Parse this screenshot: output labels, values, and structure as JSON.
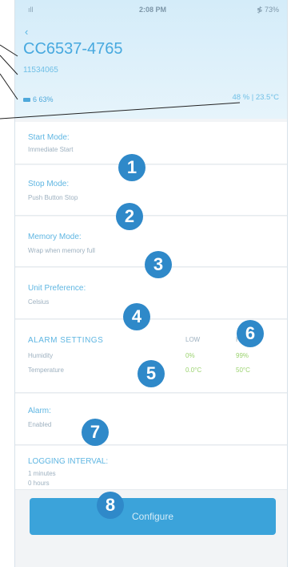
{
  "status_bar": {
    "signal": "ıll",
    "time": "2:08 PM",
    "battery": "≸ 73%"
  },
  "header": {
    "back": "‹",
    "device_name": "CC6537-4765",
    "device_sub": "11534065",
    "battery": "6 63%",
    "readings": "48 % | 23.5°C"
  },
  "settings": {
    "start_mode": {
      "label": "Start Mode:",
      "value": "Immediate Start"
    },
    "stop_mode": {
      "label": "Stop Mode:",
      "value": "Push Button Stop"
    },
    "memory_mode": {
      "label": "Memory Mode:",
      "value": "Wrap when memory full"
    },
    "unit_pref": {
      "label": "Unit Preference:",
      "value": "Celsius"
    },
    "alarm_settings": {
      "heading": "ALARM SETTINGS",
      "col_low": "LOW",
      "col_high": "HIGH",
      "rows": [
        {
          "name": "Humidity",
          "low": "0%",
          "high": "99%"
        },
        {
          "name": "Temperature",
          "low": "0.0°C",
          "high": "50°C"
        }
      ]
    },
    "alarm": {
      "label": "Alarm:",
      "value": "Enabled"
    },
    "logging": {
      "label": "LOGGING INTERVAL:",
      "line1": "1 minutes",
      "line2": "0 hours"
    }
  },
  "badges": [
    "1",
    "2",
    "3",
    "4",
    "5",
    "6",
    "7",
    "8"
  ],
  "configure_button": "Configure"
}
